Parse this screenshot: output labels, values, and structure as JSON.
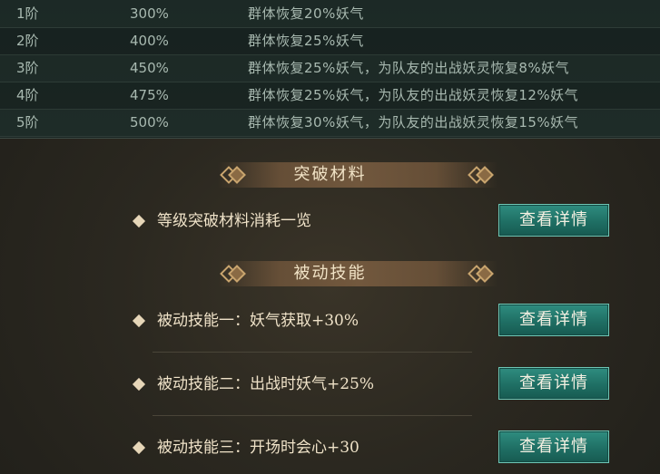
{
  "rank_table": {
    "rows": [
      {
        "rank": "1阶",
        "percent": "300%",
        "effect": "群体恢复20%妖气"
      },
      {
        "rank": "2阶",
        "percent": "400%",
        "effect": "群体恢复25%妖气"
      },
      {
        "rank": "3阶",
        "percent": "450%",
        "effect": "群体恢复25%妖气，为队友的出战妖灵恢复8%妖气"
      },
      {
        "rank": "4阶",
        "percent": "475%",
        "effect": "群体恢复25%妖气，为队友的出战妖灵恢复12%妖气"
      },
      {
        "rank": "5阶",
        "percent": "500%",
        "effect": "群体恢复30%妖气，为队友的出战妖灵恢复15%妖气"
      }
    ]
  },
  "breakthrough": {
    "title": "突破材料",
    "items": [
      {
        "label": "等级突破材料消耗一览",
        "button": "查看详情"
      }
    ]
  },
  "passive": {
    "title": "被动技能",
    "items": [
      {
        "label": "被动技能一：妖气获取+30%",
        "button": "查看详情"
      },
      {
        "label": "被动技能二：出战时妖气+25%",
        "button": "查看详情"
      },
      {
        "label": "被动技能三：开场时会心+30",
        "button": "查看详情"
      }
    ]
  }
}
